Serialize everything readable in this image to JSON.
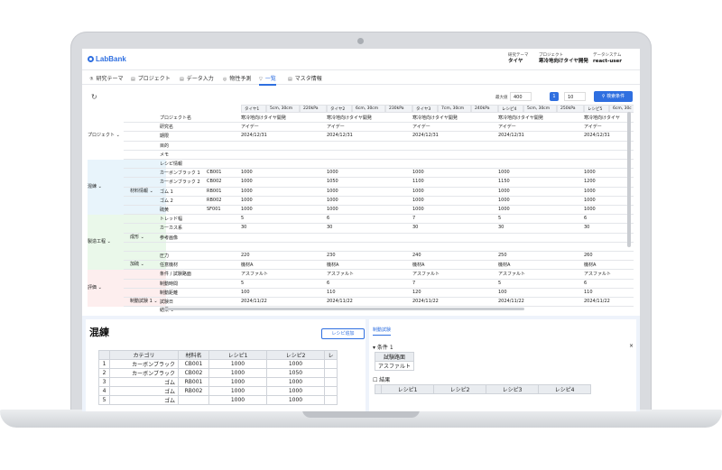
{
  "app": {
    "logo": "LabBank"
  },
  "header": {
    "meta": [
      {
        "label": "研究テーマ",
        "value": "タイヤ"
      },
      {
        "label": "プロジェクト",
        "value": "寒冷地向けタイヤ開発"
      },
      {
        "label": "データシステム",
        "value": "react-user"
      }
    ]
  },
  "nav": [
    "研究テーマ",
    "プロジェクト",
    "データ入力",
    "物性予測",
    "一覧",
    "マスタ情報"
  ],
  "nav_active": 4,
  "toolbar": {
    "max_label": "最大値",
    "max_value": "400",
    "page": "1",
    "per_page": "10",
    "search_label": "検索条件"
  },
  "grid": {
    "col_headers": [
      "タイヤ1",
      "5cm, 30cm",
      "220kPa",
      "タイヤ2",
      "6cm, 30cm",
      "230kPa",
      "タイヤ3",
      "7cm, 30cm",
      "240kPa",
      "レシピ4",
      "5cm, 30cm",
      "250kPa",
      "レシピ5",
      "6cm, 30c"
    ],
    "groups": [
      {
        "label": "プロジェクト",
        "color": "#ffffff"
      },
      {
        "label": "混練",
        "color": "#e8f4fb"
      },
      {
        "label": "製造工程",
        "color": "#eaf8ea"
      },
      {
        "label": "評価",
        "color": "#fdeeee"
      }
    ],
    "row_labels": [
      [
        "プロジェクト名",
        ""
      ],
      [
        "研究名",
        ""
      ],
      [
        "期限",
        ""
      ],
      [
        "目的",
        ""
      ],
      [
        "メモ",
        ""
      ],
      [
        "レシピ情報",
        ""
      ],
      [
        "カーボンブラック 1",
        "CB001"
      ],
      [
        "カーボンブラック 2",
        "CB002"
      ],
      [
        "ゴム 1",
        "RB001"
      ],
      [
        "ゴム 2",
        "RB002"
      ],
      [
        "硫黄",
        "SF001"
      ],
      [
        "トレッド幅",
        ""
      ],
      [
        "カーカス系",
        ""
      ],
      [
        "参考画像",
        ""
      ],
      [
        "",
        ""
      ],
      [
        "圧力",
        ""
      ],
      [
        "任意機材",
        ""
      ],
      [
        "条件 / 試験路面",
        ""
      ],
      [
        "制動時間",
        ""
      ],
      [
        "制動距離",
        ""
      ],
      [
        "試験日",
        ""
      ]
    ],
    "sub_labels": [
      "材料情報",
      "成形",
      "加硫",
      "制動試験 1",
      "結果"
    ],
    "values": [
      [
        "寒冷地向けタイヤ開発",
        "寒冷地向けタイヤ開発",
        "寒冷地向けタイヤ開発",
        "寒冷地向けタイヤ開発",
        "寒冷地向けタイヤ"
      ],
      [
        "アイデー",
        "アイデー",
        "アイデー",
        "アイデー",
        "アイデー"
      ],
      [
        "2024/12/31",
        "2024/12/31",
        "2024/12/31",
        "2024/12/31",
        "2024/12/31"
      ],
      [
        "",
        "",
        "",
        "",
        ""
      ],
      [
        "",
        "",
        "",
        "",
        ""
      ],
      [
        "",
        "",
        "",
        "",
        ""
      ],
      [
        "1000",
        "1000",
        "1000",
        "1000",
        "1000"
      ],
      [
        "1000",
        "1050",
        "1100",
        "1150",
        "1200"
      ],
      [
        "1000",
        "1000",
        "1000",
        "1000",
        "1000"
      ],
      [
        "1000",
        "1000",
        "1000",
        "1000",
        "1000"
      ],
      [
        "1000",
        "1000",
        "1000",
        "1000",
        "1000"
      ],
      [
        "5",
        "6",
        "7",
        "5",
        "6"
      ],
      [
        "30",
        "30",
        "30",
        "30",
        "30"
      ],
      [
        "",
        "",
        "",
        "",
        ""
      ],
      [
        "",
        "",
        "",
        "",
        ""
      ],
      [
        "220",
        "230",
        "240",
        "250",
        "260"
      ],
      [
        "機材A",
        "機材A",
        "機材A",
        "機材A",
        "機材A"
      ],
      [
        "アスファルト",
        "アスファルト",
        "アスファルト",
        "アスファルト",
        "アスファルト"
      ],
      [
        "5",
        "6",
        "7",
        "5",
        "6"
      ],
      [
        "100",
        "110",
        "120",
        "100",
        "110"
      ],
      [
        "2024/11/22",
        "2024/11/22",
        "2024/11/22",
        "2024/11/22",
        "2024/11/22"
      ]
    ]
  },
  "konren": {
    "title": "混練",
    "add_button": "レシピ追加",
    "headers": [
      "",
      "カテゴリ",
      "材料名",
      "レシピ1",
      "レシピ2",
      "レ"
    ],
    "rows": [
      [
        "1",
        "カーボンブラック",
        "CB001",
        "1000",
        "1000"
      ],
      [
        "2",
        "カーボンブラック",
        "CB002",
        "1000",
        "1050"
      ],
      [
        "3",
        "ゴム",
        "RB001",
        "1000",
        "1000"
      ],
      [
        "4",
        "ゴム",
        "RB002",
        "1000",
        "1000"
      ],
      [
        "5",
        "ゴム",
        "",
        "1000",
        "1000"
      ]
    ]
  },
  "seido": {
    "tab": "制動試験",
    "condition": "条件 1",
    "road_label": "試験路面",
    "road_value": "アスファルト",
    "result": "結果",
    "result_headers": [
      "レシピ1",
      "レシピ2",
      "レシピ3",
      "レシピ4"
    ]
  }
}
